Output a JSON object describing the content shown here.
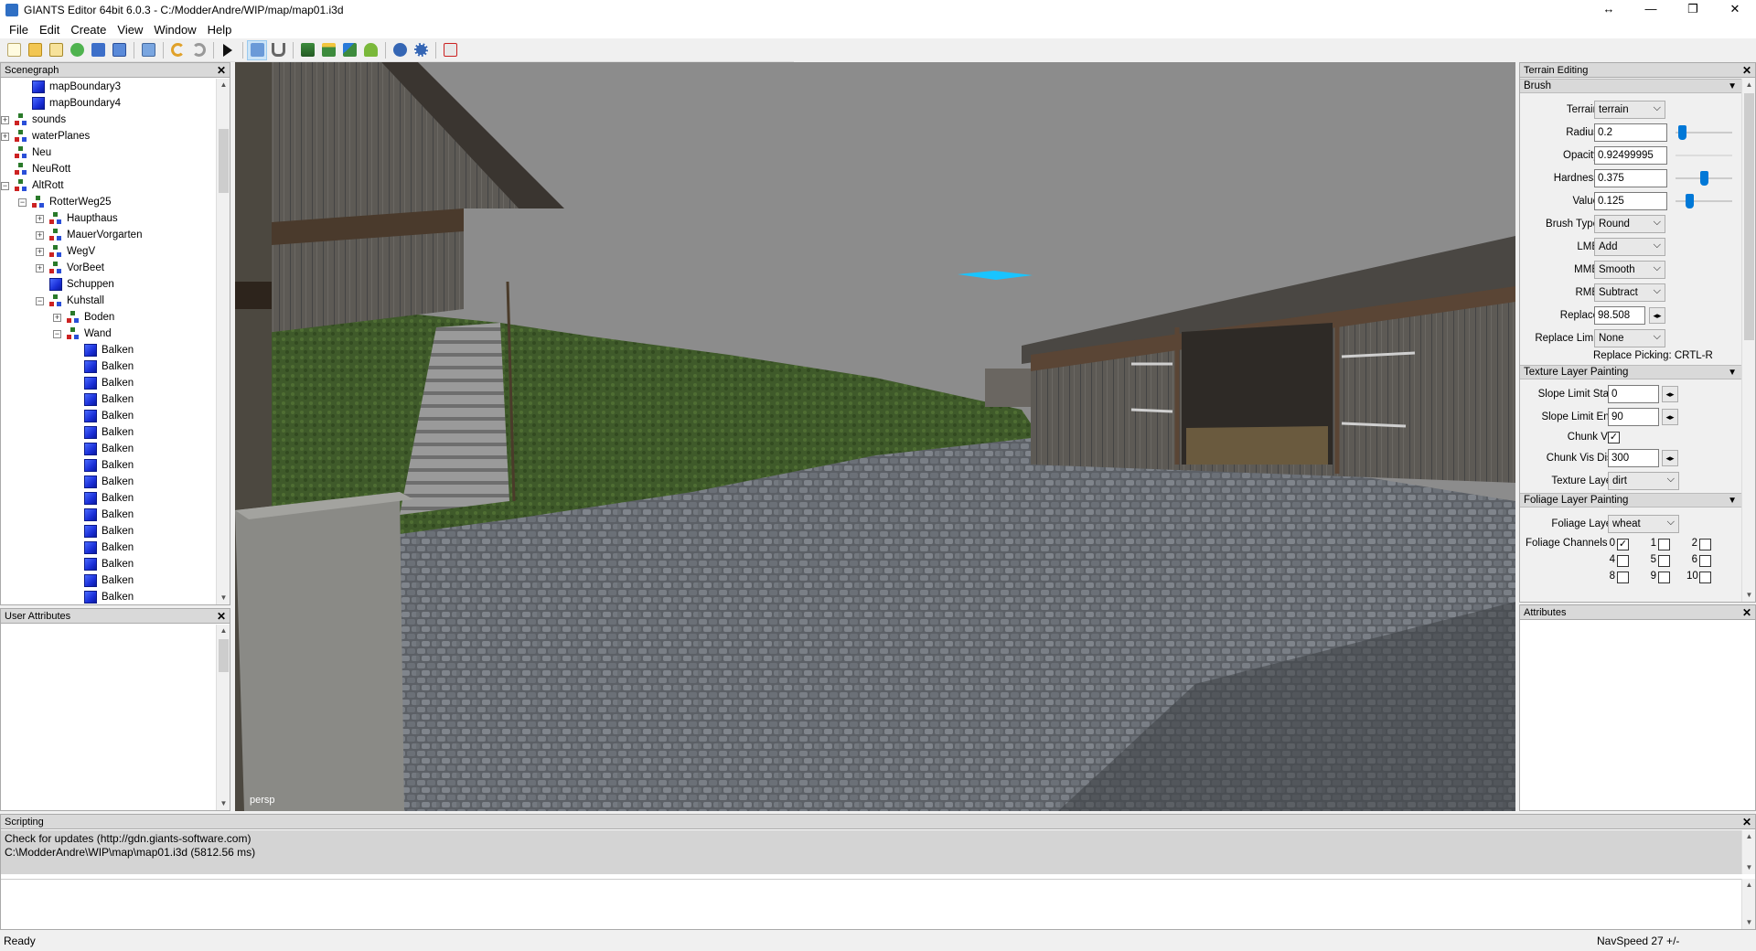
{
  "window": {
    "title": "GIANTS Editor 64bit 6.0.3 - C:/ModderAndre/WIP/map/map01.i3d",
    "minimize_glyph": "—",
    "maximize_glyph": "❐",
    "close_glyph": "✕",
    "resize_glyph": "↔"
  },
  "menu": [
    "File",
    "Edit",
    "Create",
    "View",
    "Window",
    "Help"
  ],
  "scenegraph": {
    "title": "Scenegraph",
    "items": [
      {
        "label": "mapBoundary3",
        "depth": 2,
        "icon": "cube",
        "expander": ""
      },
      {
        "label": "mapBoundary4",
        "depth": 2,
        "icon": "cube",
        "expander": ""
      },
      {
        "label": "sounds",
        "depth": 1,
        "icon": "group",
        "expander": "+"
      },
      {
        "label": "waterPlanes",
        "depth": 1,
        "icon": "group",
        "expander": "+"
      },
      {
        "label": "Neu",
        "depth": 1,
        "icon": "group",
        "expander": ""
      },
      {
        "label": "NeuRott",
        "depth": 1,
        "icon": "group",
        "expander": ""
      },
      {
        "label": "AltRott",
        "depth": 1,
        "icon": "group",
        "expander": "-"
      },
      {
        "label": "RotterWeg25",
        "depth": 2,
        "icon": "group",
        "expander": "-"
      },
      {
        "label": "Haupthaus",
        "depth": 3,
        "icon": "group",
        "expander": "+"
      },
      {
        "label": "MauerVorgarten",
        "depth": 3,
        "icon": "group",
        "expander": "+"
      },
      {
        "label": "WegV",
        "depth": 3,
        "icon": "group",
        "expander": "+"
      },
      {
        "label": "VorBeet",
        "depth": 3,
        "icon": "group",
        "expander": "+"
      },
      {
        "label": "Schuppen",
        "depth": 3,
        "icon": "cube",
        "expander": ""
      },
      {
        "label": "Kuhstall",
        "depth": 3,
        "icon": "group",
        "expander": "-"
      },
      {
        "label": "Boden",
        "depth": 4,
        "icon": "group",
        "expander": "+"
      },
      {
        "label": "Wand",
        "depth": 4,
        "icon": "group",
        "expander": "-"
      },
      {
        "label": "Balken",
        "depth": 5,
        "icon": "cube",
        "expander": ""
      },
      {
        "label": "Balken",
        "depth": 5,
        "icon": "cube",
        "expander": ""
      },
      {
        "label": "Balken",
        "depth": 5,
        "icon": "cube",
        "expander": ""
      },
      {
        "label": "Balken",
        "depth": 5,
        "icon": "cube",
        "expander": ""
      },
      {
        "label": "Balken",
        "depth": 5,
        "icon": "cube",
        "expander": ""
      },
      {
        "label": "Balken",
        "depth": 5,
        "icon": "cube",
        "expander": ""
      },
      {
        "label": "Balken",
        "depth": 5,
        "icon": "cube",
        "expander": ""
      },
      {
        "label": "Balken",
        "depth": 5,
        "icon": "cube",
        "expander": ""
      },
      {
        "label": "Balken",
        "depth": 5,
        "icon": "cube",
        "expander": ""
      },
      {
        "label": "Balken",
        "depth": 5,
        "icon": "cube",
        "expander": ""
      },
      {
        "label": "Balken",
        "depth": 5,
        "icon": "cube",
        "expander": ""
      },
      {
        "label": "Balken",
        "depth": 5,
        "icon": "cube",
        "expander": ""
      },
      {
        "label": "Balken",
        "depth": 5,
        "icon": "cube",
        "expander": ""
      },
      {
        "label": "Balken",
        "depth": 5,
        "icon": "cube",
        "expander": ""
      },
      {
        "label": "Balken",
        "depth": 5,
        "icon": "cube",
        "expander": ""
      },
      {
        "label": "Balken",
        "depth": 5,
        "icon": "cube",
        "expander": ""
      }
    ]
  },
  "user_attributes": {
    "title": "User Attributes"
  },
  "viewport": {
    "camera_label": "persp"
  },
  "terrain_editing": {
    "title": "Terrain Editing",
    "brush": {
      "title": "Brush",
      "terrain_label": "Terrain",
      "terrain_value": "terrain",
      "radius_label": "Radius",
      "radius_value": "0.2",
      "radius_slider": 0.05,
      "opacity_label": "Opacity",
      "opacity_value": "0.92499995",
      "hardness_label": "Hardness",
      "hardness_value": "0.375",
      "hardness_slider": 0.5,
      "value_label": "Value",
      "value_value": "0.125",
      "value_slider": 0.2,
      "brush_type_label": "Brush Type",
      "brush_type_value": "Round",
      "lmb_label": "LMB",
      "lmb_value": "Add",
      "mmb_label": "MMB",
      "mmb_value": "Smooth",
      "rmb_label": "RMB",
      "rmb_value": "Subtract",
      "replace_label": "Replace",
      "replace_value": "98.508",
      "replace_limit_label": "Replace Limit",
      "replace_limit_value": "None",
      "replace_picking_text": "Replace Picking: CRTL-R"
    },
    "texture": {
      "title": "Texture Layer Painting",
      "slope_start_label": "Slope Limit Start",
      "slope_start_value": "0",
      "slope_end_label": "Slope Limit End",
      "slope_end_value": "90",
      "chunk_vis_label": "Chunk Vis",
      "chunk_vis_dist_label": "Chunk Vis Dist",
      "chunk_vis_dist_value": "300",
      "texture_layer_label": "Texture Layer",
      "texture_layer_value": "dirt"
    },
    "foliage": {
      "title": "Foliage Layer Painting",
      "foliage_layer_label": "Foliage Layer",
      "foliage_layer_value": "wheat",
      "foliage_channels_label": "Foliage Channels",
      "channels": [
        {
          "n": "0",
          "checked": true
        },
        {
          "n": "1",
          "checked": false
        },
        {
          "n": "2",
          "checked": false
        },
        {
          "n": "4",
          "checked": false
        },
        {
          "n": "5",
          "checked": false
        },
        {
          "n": "6",
          "checked": false
        },
        {
          "n": "8",
          "checked": false
        },
        {
          "n": "9",
          "checked": false
        },
        {
          "n": "10",
          "checked": false
        }
      ]
    }
  },
  "attributes": {
    "title": "Attributes"
  },
  "scripting": {
    "title": "Scripting",
    "log": [
      "Check for updates (http://gdn.giants-software.com)",
      "C:\\ModderAndre\\WIP\\map\\map01.i3d (5812.56 ms)"
    ]
  },
  "status": {
    "text": "Ready",
    "navspeed": "NavSpeed 27 +/-"
  },
  "colors": {
    "accent": "#0078d7",
    "cube_icon": "#1f3fe6",
    "sky": "#8c8c8c",
    "water_plane": "#19c4ff"
  }
}
